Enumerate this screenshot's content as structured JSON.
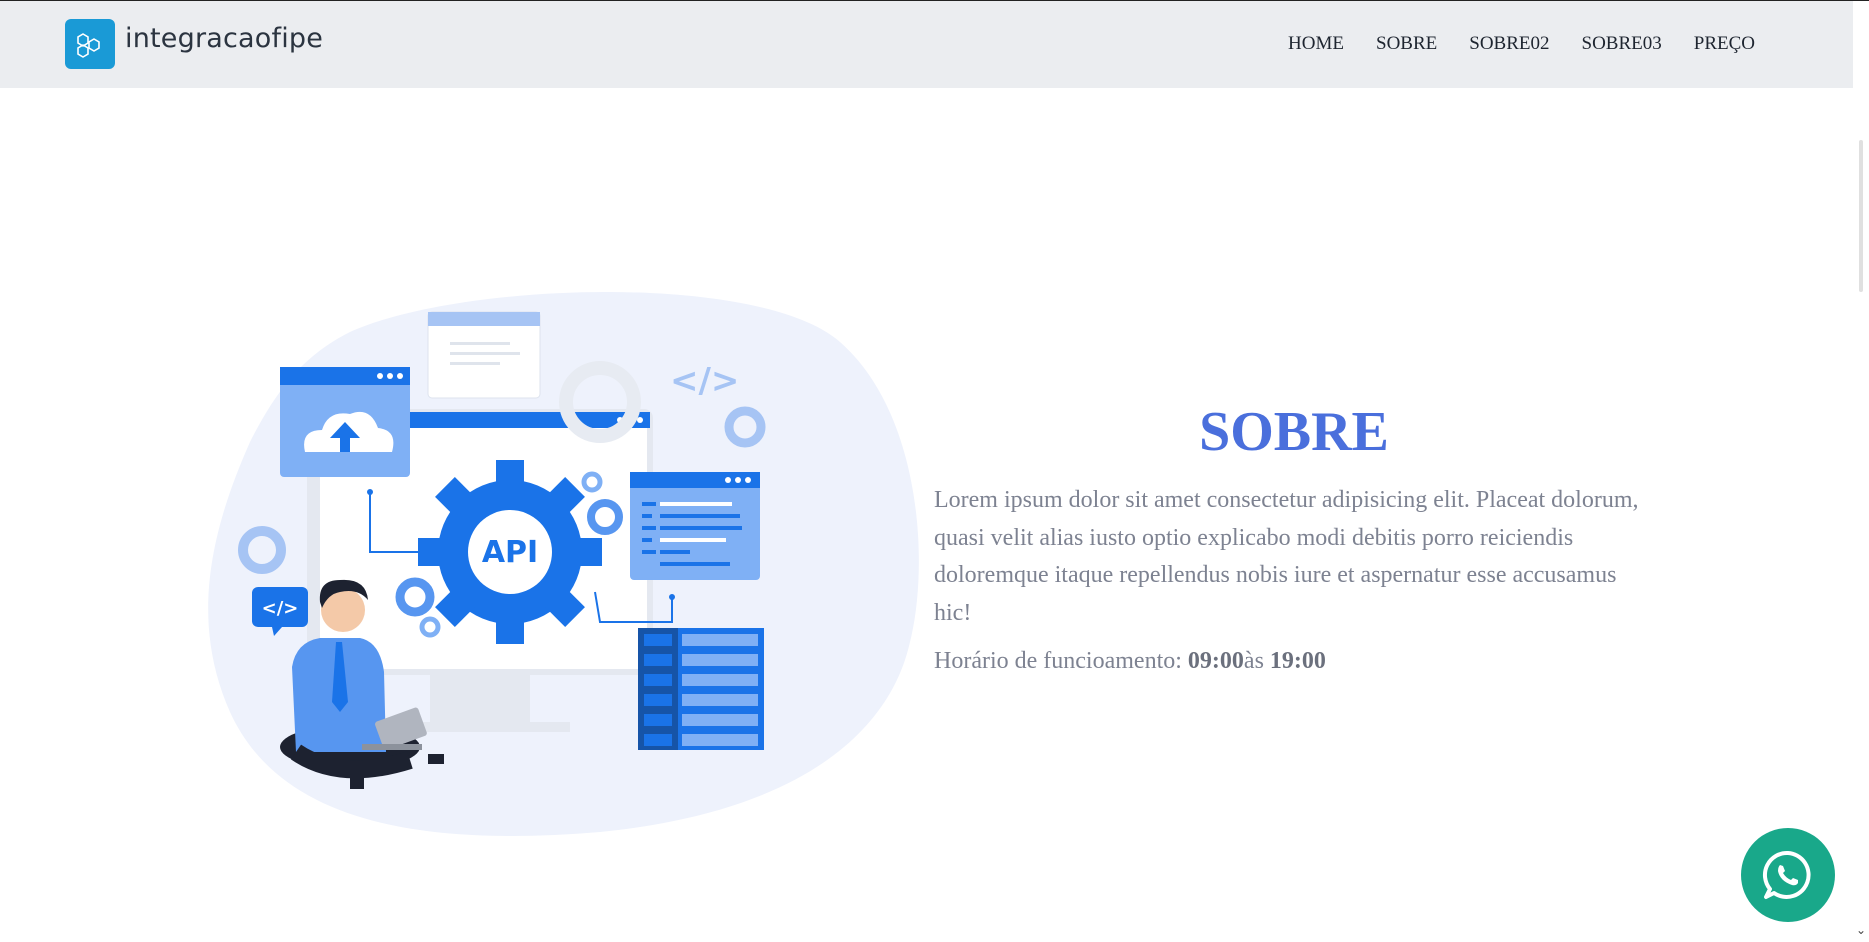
{
  "brand": {
    "name": "integracaofipe",
    "icon": "hexagon-logo-icon",
    "color": "#1a9ad6"
  },
  "nav": {
    "items": [
      {
        "label": "HOME"
      },
      {
        "label": "SOBRE"
      },
      {
        "label": "SOBRE02"
      },
      {
        "label": "SOBRE03"
      },
      {
        "label": "PREÇO"
      }
    ]
  },
  "about": {
    "title": "SOBRE",
    "body": "Lorem ipsum dolor sit amet consectetur adipisicing elit. Placeat dolorum, quasi velit alias iusto optio explicabo modi debitis porro reiciendis doloremque itaque repellendus nobis iure et aspernatur esse accusamus hic!",
    "hours_prefix": "Horário de funcioamento: ",
    "hours_open": "09:00",
    "hours_sep": "às ",
    "hours_close": "19:00",
    "title_color": "#4a6fdc"
  },
  "illustration": {
    "icon": "api-developer-illustration",
    "api_label": "API",
    "code_tag": "</>"
  },
  "whatsapp": {
    "icon": "whatsapp-icon",
    "color": "#19a88a"
  }
}
